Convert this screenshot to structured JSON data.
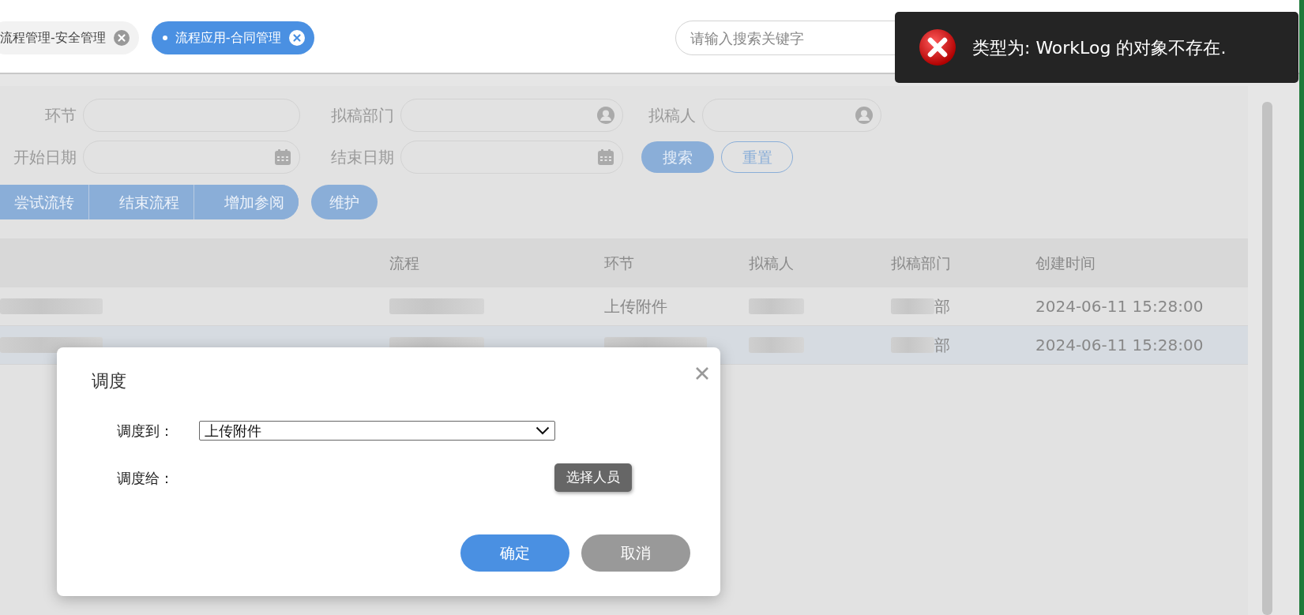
{
  "header_tabs": [
    {
      "label": "流程管理-安全管理",
      "selected": false
    },
    {
      "label": "流程应用-合同管理",
      "selected": true
    }
  ],
  "search": {
    "placeholder": "请输入搜索关键字"
  },
  "toast": {
    "kind": "error",
    "message": "类型为: WorkLog 的对象不存在."
  },
  "filters": [
    {
      "label": "环节",
      "kind": "text"
    },
    {
      "label": "拟稿部门",
      "kind": "person"
    },
    {
      "label": "拟稿人",
      "kind": "person"
    },
    {
      "label": "开始日期",
      "kind": "date"
    },
    {
      "label": "结束日期",
      "kind": "date"
    }
  ],
  "filter_buttons": [
    {
      "label": "搜索",
      "kind": "primary"
    },
    {
      "label": "重置",
      "kind": "outline"
    }
  ],
  "action_group": [
    "尝试流转",
    "结束流程",
    "增加参阅"
  ],
  "action_single": [
    "维护"
  ],
  "table": {
    "columns": [
      "",
      "流程",
      "环节",
      "拟稿人",
      "拟稿部门",
      "创建时间"
    ],
    "rows": [
      {
        "selected": false,
        "cells": [
          {
            "kind": "blur"
          },
          {
            "kind": "blur"
          },
          {
            "kind": "text",
            "text": "上传附件"
          },
          {
            "kind": "blur"
          },
          {
            "kind": "tail",
            "text": "部"
          },
          {
            "kind": "text",
            "text": "2024-06-11 15:28:00"
          }
        ]
      },
      {
        "selected": true,
        "cells": [
          {
            "kind": "blur"
          },
          {
            "kind": "blur"
          },
          {
            "kind": "blur"
          },
          {
            "kind": "blur"
          },
          {
            "kind": "tail",
            "text": "部"
          },
          {
            "kind": "text",
            "text": "2024-06-11 15:28:00"
          }
        ]
      }
    ]
  },
  "dialog": {
    "title": "调度",
    "fields": [
      {
        "label": "调度到：",
        "kind": "select",
        "value": "上传附件"
      },
      {
        "label": "调度给：",
        "kind": "picker",
        "button": "选择人员"
      }
    ],
    "buttons": [
      {
        "label": "确定",
        "kind": "primary"
      },
      {
        "label": "取消",
        "kind": "secondary"
      }
    ]
  }
}
